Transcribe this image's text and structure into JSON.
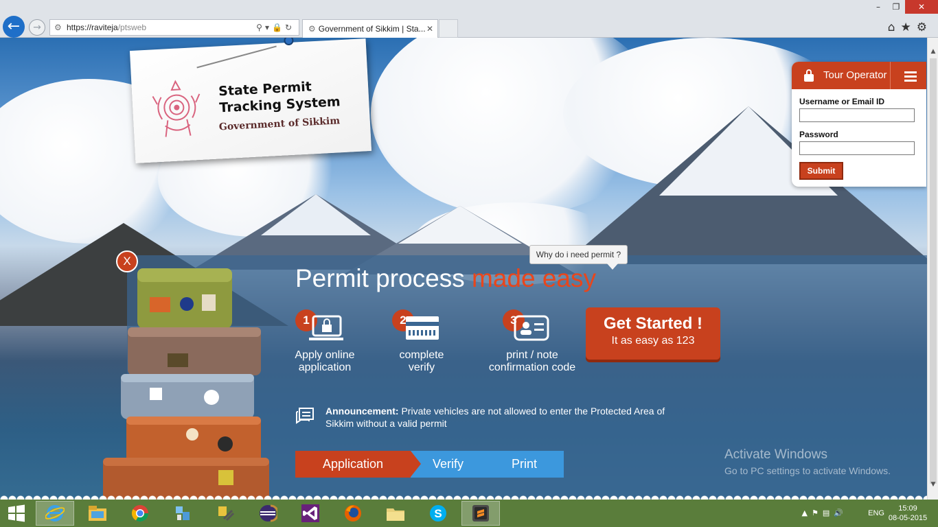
{
  "browser": {
    "url_prefix": "https://",
    "url_host": "raviteja",
    "url_path": "/ptsweb",
    "tab_title": "Government of Sikkim | Sta...",
    "colors": {
      "back_button": "#1f6fc8",
      "close_button": "#c7382c"
    }
  },
  "logo": {
    "title": "State Permit Tracking System",
    "subtitle": "Government of Sikkim"
  },
  "login": {
    "role": "Tour Operator",
    "username_label": "Username or Email ID",
    "username_value": "",
    "password_label": "Password",
    "password_value": "",
    "submit_label": "Submit"
  },
  "banner": {
    "close_label": "X",
    "why_label": "Why do i need permit ?",
    "headline": "Permit process ",
    "headline_accent": "made easy",
    "steps": [
      {
        "number": "1",
        "caption_line1": "Apply online",
        "caption_line2": "application",
        "icon": "lock-monitor-icon"
      },
      {
        "number": "2",
        "caption_line1": "complete",
        "caption_line2": "verify",
        "icon": "card-icon"
      },
      {
        "number": "3",
        "caption_line1": "print / note",
        "caption_line2": "confirmation code",
        "icon": "id-card-icon"
      }
    ],
    "cta_title": "Get Started !",
    "cta_sub": "It as easy as 123",
    "announcement_label": "Announcement:",
    "announcement_text": " Private vehicles are not allowed to enter the Protected Area of Sikkim without a valid permit",
    "flow": [
      "Application",
      "Verify",
      "Print"
    ],
    "accent_color": "#c8411e",
    "flow_blue": "#3c98dd"
  },
  "watermark": {
    "line1": "Activate Windows",
    "line2": "Go to PC settings to activate Windows."
  },
  "taskbar": {
    "items": [
      "start-icon",
      "internet-explorer-icon",
      "file-explorer-icon",
      "chrome-icon",
      "network-icon",
      "tools-icon",
      "eclipse-icon",
      "visual-studio-icon",
      "firefox-icon",
      "folder-icon",
      "skype-icon",
      "sublime-text-icon"
    ],
    "lang": "ENG",
    "time": "15:09",
    "date": "08-05-2015"
  }
}
